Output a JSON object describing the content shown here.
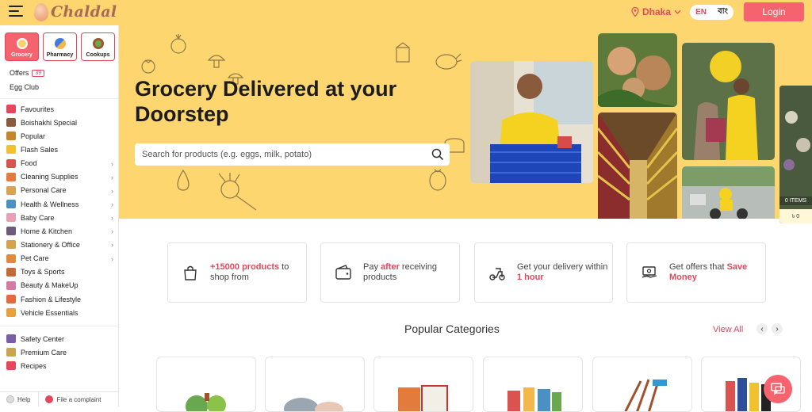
{
  "header": {
    "logo_text": "Chaldal",
    "location": "Dhaka",
    "lang_en": "EN",
    "lang_bn": "বাং",
    "login_label": "Login"
  },
  "sidebar": {
    "categories": [
      {
        "label": "Grocery"
      },
      {
        "label": "Pharmacy"
      },
      {
        "label": "Cookups"
      }
    ],
    "offers_label": "Offers",
    "offers_count": "39",
    "egg_club_label": "Egg Club",
    "items": [
      {
        "label": "Favourites",
        "chevron": false,
        "color": "#e4465b"
      },
      {
        "label": "Boishakhi Special",
        "chevron": false,
        "color": "#8a5a3c"
      },
      {
        "label": "Popular",
        "chevron": false,
        "color": "#c7842e"
      },
      {
        "label": "Flash Sales",
        "chevron": false,
        "color": "#f2c12e"
      },
      {
        "label": "Food",
        "chevron": true,
        "color": "#d9534f"
      },
      {
        "label": "Cleaning Supplies",
        "chevron": true,
        "color": "#e27b3c"
      },
      {
        "label": "Personal Care",
        "chevron": true,
        "color": "#d8a355"
      },
      {
        "label": "Health & Wellness",
        "chevron": true,
        "color": "#4a90c2"
      },
      {
        "label": "Baby Care",
        "chevron": true,
        "color": "#e9a0b4"
      },
      {
        "label": "Home & Kitchen",
        "chevron": true,
        "color": "#6c5b7b"
      },
      {
        "label": "Stationery & Office",
        "chevron": true,
        "color": "#d7a34a"
      },
      {
        "label": "Pet Care",
        "chevron": true,
        "color": "#e08a3c"
      },
      {
        "label": "Toys & Sports",
        "chevron": false,
        "color": "#c46a3a"
      },
      {
        "label": "Beauty & MakeUp",
        "chevron": false,
        "color": "#d77aa3"
      },
      {
        "label": "Fashion & Lifestyle",
        "chevron": false,
        "color": "#e26b3c"
      },
      {
        "label": "Vehicle Essentials",
        "chevron": false,
        "color": "#e8a23b"
      }
    ],
    "bottom_items": [
      {
        "label": "Safety Center",
        "color": "#7b5ea7"
      },
      {
        "label": "Premium Care",
        "color": "#c9a54c"
      },
      {
        "label": "Recipes",
        "color": "#e4465b"
      }
    ],
    "footer": {
      "help_label": "Help",
      "complaint_label": "File a complaint"
    }
  },
  "hero": {
    "title": "Grocery Delivered at your Doorstep",
    "search_placeholder": "Search for products (e.g. eggs, milk, potato)"
  },
  "cart": {
    "items_label": "0 ITEMS",
    "price": "৳ 0"
  },
  "features": [
    {
      "highlight": "+15000 products",
      "text_after": " to shop from",
      "text_before": ""
    },
    {
      "text_before": "Pay ",
      "highlight": "after",
      "text_after": " receiving products"
    },
    {
      "text_before": "Get your delivery within ",
      "highlight": "1 hour",
      "text_after": ""
    },
    {
      "text_before": "Get offers that ",
      "highlight": "Save Money",
      "text_after": ""
    }
  ],
  "popular": {
    "title": "Popular Categories",
    "view_all": "View All",
    "prev": "‹",
    "next": "›"
  },
  "colors": {
    "brand_yellow": "#fdd670",
    "accent_red": "#e4465b",
    "login_pink": "#f5636f"
  }
}
